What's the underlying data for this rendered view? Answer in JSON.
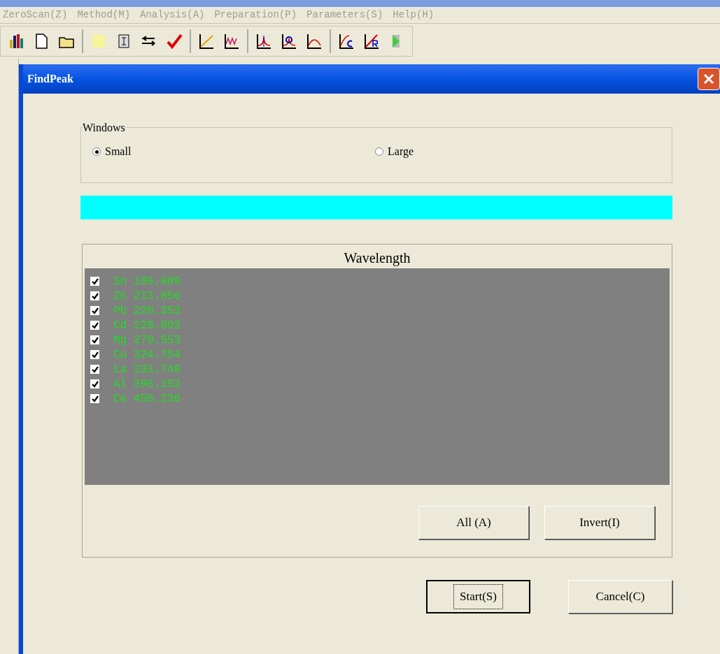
{
  "menu": [
    "ZeroScan(Z)",
    "Method(M)",
    "Analysis(A)",
    "Preparation(P)",
    "Parameters(S)",
    "Help(H)"
  ],
  "dialog": {
    "title": "FindPeak",
    "windows": {
      "title": "Windows",
      "options": [
        {
          "label": "Small",
          "selected": true
        },
        {
          "label": "Large",
          "selected": false
        }
      ]
    },
    "progress": {
      "level": 1
    },
    "list": {
      "header": "Wavelength",
      "items": [
        {
          "label": "Sn 189.989",
          "checked": true
        },
        {
          "label": "Zn 213.856",
          "checked": true
        },
        {
          "label": "Pb 220.353",
          "checked": true
        },
        {
          "label": "Cd 228.802",
          "checked": true
        },
        {
          "label": "Mg 279.553",
          "checked": true
        },
        {
          "label": "Cu 324.754",
          "checked": true
        },
        {
          "label": "La 333.749",
          "checked": true
        },
        {
          "label": "Al 396.152",
          "checked": true
        },
        {
          "label": "Ce 456.236",
          "checked": true
        }
      ],
      "buttons": [
        "All (A)",
        "Invert(I)"
      ]
    },
    "actions": [
      {
        "label": "Start(S)",
        "default": true
      },
      {
        "label": "Cancel(C)",
        "default": false
      }
    ]
  }
}
